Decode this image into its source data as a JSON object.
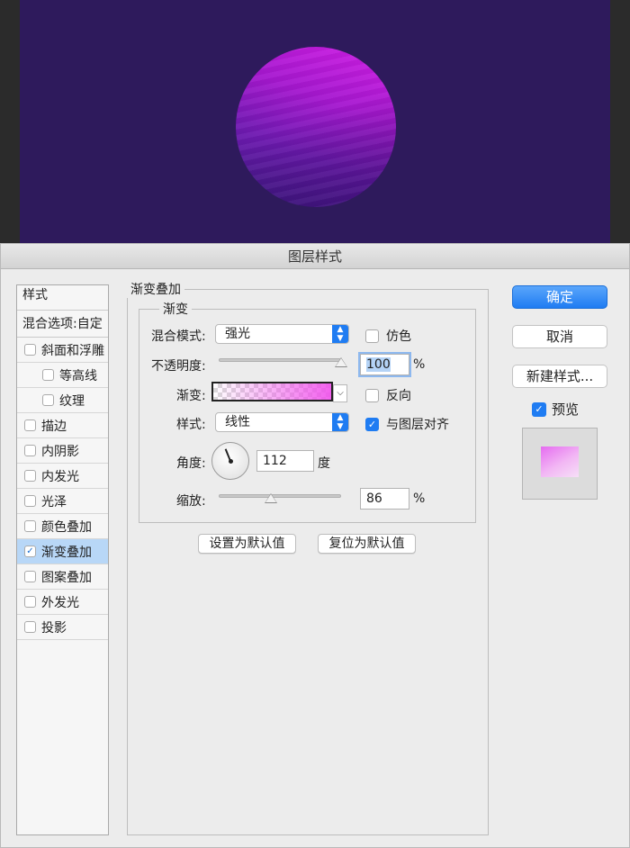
{
  "dialog": {
    "title": "图层样式",
    "styles_header": "样式",
    "blending_options": "混合选项:自定",
    "items": [
      {
        "label": "斜面和浮雕",
        "checked": false,
        "sub": false
      },
      {
        "label": "等高线",
        "checked": false,
        "sub": true
      },
      {
        "label": "纹理",
        "checked": false,
        "sub": true
      },
      {
        "label": "描边",
        "checked": false,
        "sub": false
      },
      {
        "label": "内阴影",
        "checked": false,
        "sub": false
      },
      {
        "label": "内发光",
        "checked": false,
        "sub": false
      },
      {
        "label": "光泽",
        "checked": false,
        "sub": false
      },
      {
        "label": "颜色叠加",
        "checked": false,
        "sub": false
      },
      {
        "label": "渐变叠加",
        "checked": true,
        "sub": false
      },
      {
        "label": "图案叠加",
        "checked": false,
        "sub": false
      },
      {
        "label": "外发光",
        "checked": false,
        "sub": false
      },
      {
        "label": "投影",
        "checked": false,
        "sub": false
      }
    ]
  },
  "gradient_overlay": {
    "group_title": "渐变叠加",
    "sub_title": "渐变",
    "blend_mode_label": "混合模式:",
    "blend_mode_value": "强光",
    "dither_label": "仿色",
    "dither_checked": false,
    "opacity_label": "不透明度:",
    "opacity_value": "100",
    "opacity_unit": "%",
    "opacity_level": 1.0,
    "gradient_label": "渐变:",
    "reverse_label": "反向",
    "reverse_checked": false,
    "style_label": "样式:",
    "style_value": "线性",
    "align_label": "与图层对齐",
    "align_checked": true,
    "angle_label": "角度:",
    "angle_value": "112",
    "angle_unit": "度",
    "scale_label": "缩放:",
    "scale_value": "86",
    "scale_unit": "%",
    "scale_level": 0.43,
    "make_default": "设置为默认值",
    "reset_default": "复位为默认值"
  },
  "buttons": {
    "ok": "确定",
    "cancel": "取消",
    "new_style": "新建样式...",
    "preview": "预览",
    "preview_checked": true
  },
  "colors": {
    "canvas_bg": "#2e1a5c",
    "accent": "#1f7cf2",
    "sphere_top": "#d21ee6",
    "sphere_bottom": "#3f1a85",
    "gradient_end": "#f150ec"
  }
}
